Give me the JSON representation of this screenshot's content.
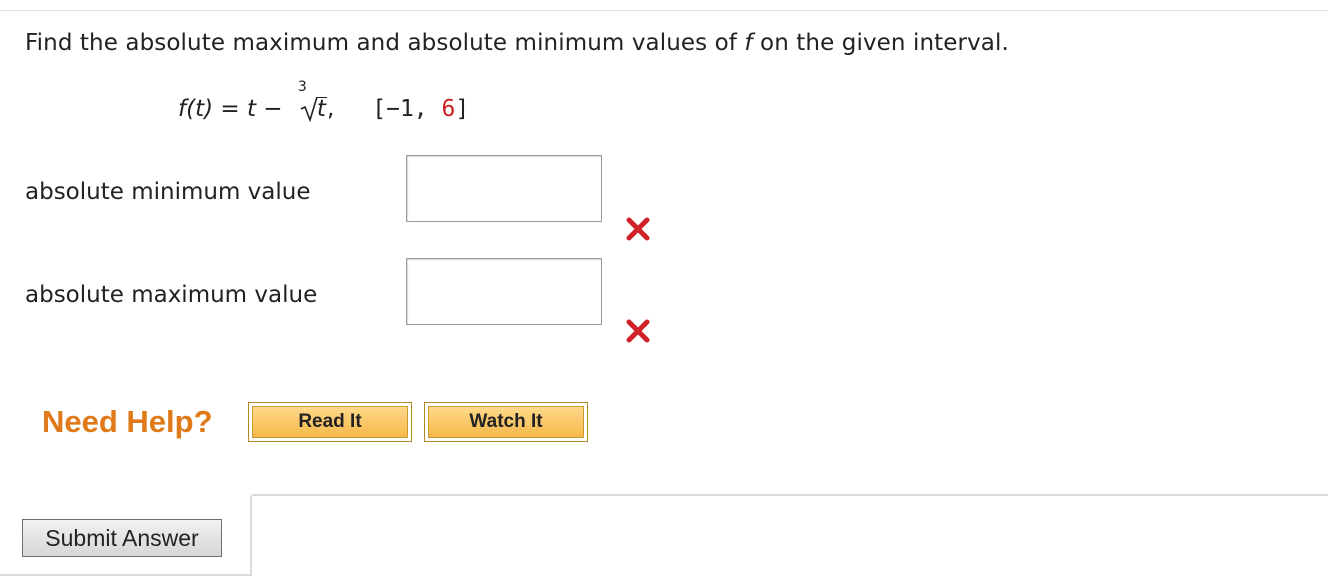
{
  "question": {
    "prefix": "Find the absolute maximum and absolute minimum values of ",
    "variable": "f",
    "suffix": " on the given interval."
  },
  "formula": {
    "lhs": "f(t)",
    "equals": " = ",
    "t_term": "t",
    "minus": " − ",
    "root_index": "3",
    "radicand": "t",
    "comma": ",",
    "interval_open": "[−1, ",
    "interval_end": "6",
    "interval_close": "]",
    "interval_end_color": "#cc2020"
  },
  "fields": [
    {
      "label": "absolute minimum value",
      "value": "",
      "status": "incorrect"
    },
    {
      "label": "absolute maximum value",
      "value": "",
      "status": "incorrect"
    }
  ],
  "help": {
    "title": "Need Help?",
    "read_it": "Read It",
    "watch_it": "Watch It"
  },
  "submit_label": "Submit Answer",
  "colors": {
    "incorrect_mark": "#d0202a",
    "need_help": "#e07a18",
    "help_button": "#f5b84a"
  },
  "icons": {
    "incorrect": "close-x-icon"
  }
}
